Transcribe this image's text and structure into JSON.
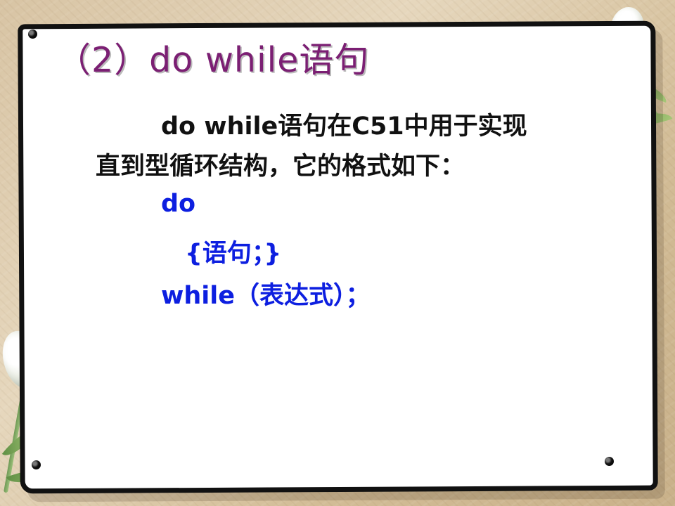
{
  "slide": {
    "title": "（2）do  while语句",
    "paragraph": {
      "line1": "do  while语句在C51中用于实现",
      "line2": "直到型循环结构，它的格式如下："
    },
    "code": {
      "line1": "do",
      "line2": "{语句；}",
      "line3": "while（表达式）；"
    },
    "colors": {
      "title": "#7b1f73",
      "body": "#111111",
      "code": "#0d1fe0"
    }
  }
}
